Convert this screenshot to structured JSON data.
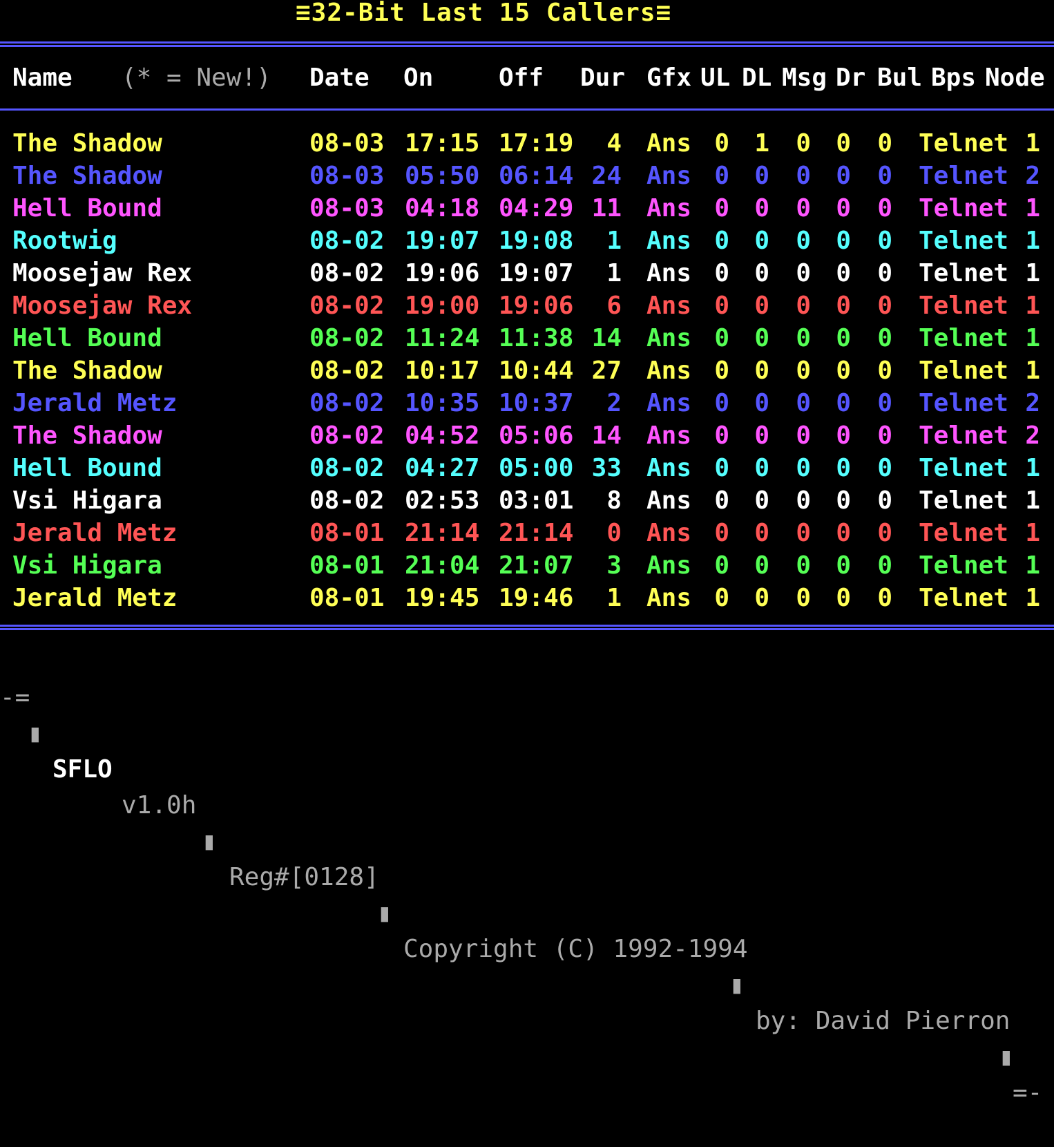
{
  "title": "≡32-Bit Last 15 Callers≡",
  "colors": {
    "yellow": "#ffff55",
    "blue": "#5555ff",
    "magenta": "#ff55ff",
    "cyan": "#55ffff",
    "white": "#ffffff",
    "red": "#ff5555",
    "green": "#55ff55",
    "gray": "#aaaaaa"
  },
  "headers": {
    "name": "Name",
    "new_note": "(* = New!)",
    "date": "Date",
    "on": "On",
    "off": "Off",
    "dur": "Dur",
    "gfx": "Gfx",
    "ul": "UL",
    "dl": "DL",
    "msg": "Msg",
    "dr": "Dr",
    "bul": "Bul",
    "bps": "Bps",
    "node": "Node"
  },
  "callers": [
    {
      "name": "The Shadow",
      "date": "08-03",
      "on": "17:15",
      "off": "17:19",
      "dur": "4",
      "gfx": "Ans",
      "ul": "0",
      "dl": "1",
      "msg": "0",
      "dr": "0",
      "bul": "0",
      "bps": "Telnet",
      "node": "1",
      "color": "#ffff55"
    },
    {
      "name": "The Shadow",
      "date": "08-03",
      "on": "05:50",
      "off": "06:14",
      "dur": "24",
      "gfx": "Ans",
      "ul": "0",
      "dl": "0",
      "msg": "0",
      "dr": "0",
      "bul": "0",
      "bps": "Telnet",
      "node": "2",
      "color": "#5555ff"
    },
    {
      "name": "Hell Bound",
      "date": "08-03",
      "on": "04:18",
      "off": "04:29",
      "dur": "11",
      "gfx": "Ans",
      "ul": "0",
      "dl": "0",
      "msg": "0",
      "dr": "0",
      "bul": "0",
      "bps": "Telnet",
      "node": "1",
      "color": "#ff55ff"
    },
    {
      "name": "Rootwig",
      "date": "08-02",
      "on": "19:07",
      "off": "19:08",
      "dur": "1",
      "gfx": "Ans",
      "ul": "0",
      "dl": "0",
      "msg": "0",
      "dr": "0",
      "bul": "0",
      "bps": "Telnet",
      "node": "1",
      "color": "#55ffff"
    },
    {
      "name": "Moosejaw Rex",
      "date": "08-02",
      "on": "19:06",
      "off": "19:07",
      "dur": "1",
      "gfx": "Ans",
      "ul": "0",
      "dl": "0",
      "msg": "0",
      "dr": "0",
      "bul": "0",
      "bps": "Telnet",
      "node": "1",
      "color": "#ffffff"
    },
    {
      "name": "Moosejaw Rex",
      "date": "08-02",
      "on": "19:00",
      "off": "19:06",
      "dur": "6",
      "gfx": "Ans",
      "ul": "0",
      "dl": "0",
      "msg": "0",
      "dr": "0",
      "bul": "0",
      "bps": "Telnet",
      "node": "1",
      "color": "#ff5555"
    },
    {
      "name": "Hell Bound",
      "date": "08-02",
      "on": "11:24",
      "off": "11:38",
      "dur": "14",
      "gfx": "Ans",
      "ul": "0",
      "dl": "0",
      "msg": "0",
      "dr": "0",
      "bul": "0",
      "bps": "Telnet",
      "node": "1",
      "color": "#55ff55"
    },
    {
      "name": "The Shadow",
      "date": "08-02",
      "on": "10:17",
      "off": "10:44",
      "dur": "27",
      "gfx": "Ans",
      "ul": "0",
      "dl": "0",
      "msg": "0",
      "dr": "0",
      "bul": "0",
      "bps": "Telnet",
      "node": "1",
      "color": "#ffff55"
    },
    {
      "name": "Jerald Metz",
      "date": "08-02",
      "on": "10:35",
      "off": "10:37",
      "dur": "2",
      "gfx": "Ans",
      "ul": "0",
      "dl": "0",
      "msg": "0",
      "dr": "0",
      "bul": "0",
      "bps": "Telnet",
      "node": "2",
      "color": "#5555ff"
    },
    {
      "name": "The Shadow",
      "date": "08-02",
      "on": "04:52",
      "off": "05:06",
      "dur": "14",
      "gfx": "Ans",
      "ul": "0",
      "dl": "0",
      "msg": "0",
      "dr": "0",
      "bul": "0",
      "bps": "Telnet",
      "node": "2",
      "color": "#ff55ff"
    },
    {
      "name": "Hell Bound",
      "date": "08-02",
      "on": "04:27",
      "off": "05:00",
      "dur": "33",
      "gfx": "Ans",
      "ul": "0",
      "dl": "0",
      "msg": "0",
      "dr": "0",
      "bul": "0",
      "bps": "Telnet",
      "node": "1",
      "color": "#55ffff"
    },
    {
      "name": "Vsi Higara",
      "date": "08-02",
      "on": "02:53",
      "off": "03:01",
      "dur": "8",
      "gfx": "Ans",
      "ul": "0",
      "dl": "0",
      "msg": "0",
      "dr": "0",
      "bul": "0",
      "bps": "Telnet",
      "node": "1",
      "color": "#ffffff"
    },
    {
      "name": "Jerald Metz",
      "date": "08-01",
      "on": "21:14",
      "off": "21:14",
      "dur": "0",
      "gfx": "Ans",
      "ul": "0",
      "dl": "0",
      "msg": "0",
      "dr": "0",
      "bul": "0",
      "bps": "Telnet",
      "node": "1",
      "color": "#ff5555"
    },
    {
      "name": "Vsi Higara",
      "date": "08-01",
      "on": "21:04",
      "off": "21:07",
      "dur": "3",
      "gfx": "Ans",
      "ul": "0",
      "dl": "0",
      "msg": "0",
      "dr": "0",
      "bul": "0",
      "bps": "Telnet",
      "node": "1",
      "color": "#55ff55"
    },
    {
      "name": "Jerald Metz",
      "date": "08-01",
      "on": "19:45",
      "off": "19:46",
      "dur": "1",
      "gfx": "Ans",
      "ul": "0",
      "dl": "0",
      "msg": "0",
      "dr": "0",
      "bul": "0",
      "bps": "Telnet",
      "node": "1",
      "color": "#ffff55"
    }
  ],
  "footer": {
    "lead": "-=",
    "app": "SFLO",
    "version": "v1.0h",
    "reg": "Reg#[0128]",
    "copyright": "Copyright (C) 1992-1994",
    "author": "by: David Pierron",
    "trail": "=-",
    "bullet": "▮"
  }
}
